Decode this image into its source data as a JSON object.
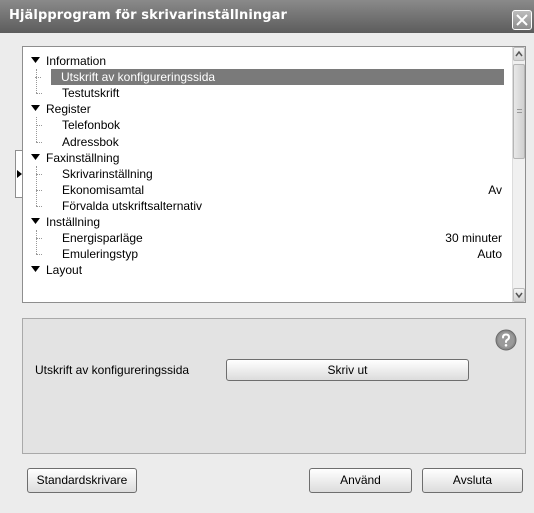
{
  "window": {
    "title": "Hjälpprogram för skrivarinställningar"
  },
  "tree": [
    {
      "label": "Information",
      "value": "",
      "level": 0,
      "expanded": true
    },
    {
      "label": "Utskrift av konfigureringssida",
      "value": "",
      "level": 1,
      "selected": true
    },
    {
      "label": "Testutskrift",
      "value": "",
      "level": 1
    },
    {
      "label": "Register",
      "value": "",
      "level": 0,
      "expanded": true
    },
    {
      "label": "Telefonbok",
      "value": "",
      "level": 1
    },
    {
      "label": "Adressbok",
      "value": "",
      "level": 1
    },
    {
      "label": "Faxinställning",
      "value": "",
      "level": 0,
      "expanded": true
    },
    {
      "label": "Skrivarinställning",
      "value": "",
      "level": 1
    },
    {
      "label": "Ekonomisamtal",
      "value": "Av",
      "level": 1
    },
    {
      "label": "Förvalda utskriftsalternativ",
      "value": "",
      "level": 1
    },
    {
      "label": "Inställning",
      "value": "",
      "level": 0,
      "expanded": true
    },
    {
      "label": "Energisparläge",
      "value": "30 minuter",
      "level": 1
    },
    {
      "label": "Emuleringstyp",
      "value": "Auto",
      "level": 1
    },
    {
      "label": "Layout",
      "value": "",
      "level": 0,
      "expanded": true
    }
  ],
  "action": {
    "label": "Utskrift av konfigureringssida",
    "button": "Skriv ut"
  },
  "footer": {
    "default_printer": "Standardskrivare",
    "apply": "Använd",
    "exit": "Avsluta"
  },
  "icons": {
    "close": "close-icon",
    "help": "help-icon",
    "expand": "triangle-down-icon",
    "scroll_up": "arrow-up-icon",
    "scroll_down": "arrow-down-icon",
    "side_tab": "triangle-right-icon"
  },
  "colors": {
    "titlebar": "#6f6f6f",
    "selection": "#7a7a7a",
    "panel": "#e3e3e3"
  }
}
